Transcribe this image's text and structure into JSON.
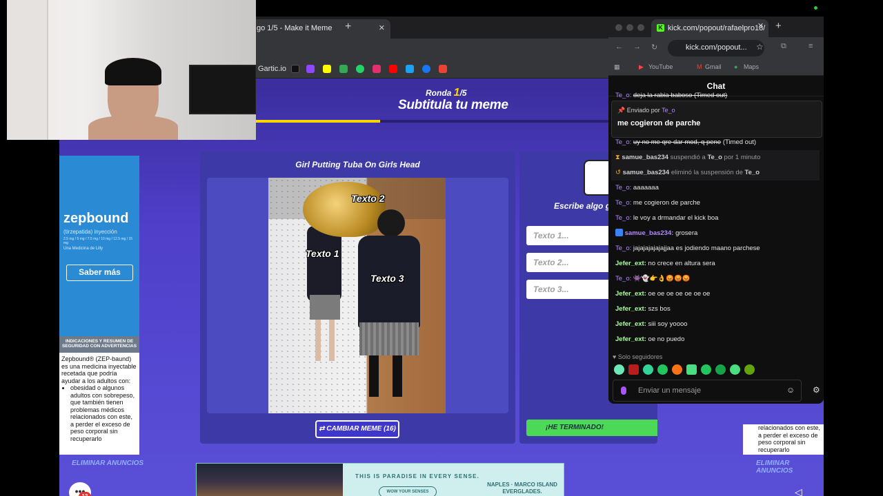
{
  "main_browser": {
    "tab_title": "go 1/5 - Make it Meme",
    "tab_close": "✕",
    "new_tab": "+",
    "bookmark_label": "Gartic.io"
  },
  "game": {
    "round_prefix": "Ronda ",
    "round_current": "1",
    "round_total": "/5",
    "subtitle": "Subtitula tu meme",
    "progress": 0.3,
    "meme_title": "Girl Putting Tuba On Girls Head",
    "meme_labels": {
      "t1": "Texto 1",
      "t2": "Texto 2",
      "t3": "Texto 3"
    },
    "cambiar_label": "CAMBIAR MEME (16)",
    "escribe_label": "Escribe algo gra",
    "inputs": {
      "p1": "Texto 1...",
      "p2": "Texto 2...",
      "p3": "Texto 3..."
    },
    "terminado_label": "¡HE TERMINADO!",
    "eliminar_left": "ELIMINAR ANUNCIOS",
    "eliminar_right": "ELIMINAR ANUNCIOS",
    "chat_count": "13"
  },
  "left_ad": {
    "logo": "zepbound",
    "sub": "(tirzepatida) inyección",
    "doses": "2.5 mg / 5 mg / 7.5 mg / 10 mg / 12.5 mg / 15 mg",
    "brand": "Una Medicina de Lilly",
    "cta": "Saber más",
    "info_head": "INDICACIONES Y RESUMEN DE SEGURIDAD CON ADVERTENCIAS",
    "body_intro": "Zepbound® (ZEP-baund) es una medicina inyectable recetada que podría ayudar a los adultos con:",
    "body_bullet": "obesidad o algunos adultos con sobrepeso, que también tienen problemas médicos relacionados con este, a perder el exceso de peso corporal sin recuperarlo"
  },
  "right_ad": {
    "body": "relacionados con este, a perder el exceso de peso corporal sin recuperarlo"
  },
  "bottom_ad": {
    "headline": "THIS IS PARADISE IN EVERY SENSE.",
    "cta": "WOW YOUR SENSES",
    "brand": "NAPLES · MARCO ISLAND EVERGLADES."
  },
  "kick": {
    "tab_title": "kick.com/popout/rafaelpro18/",
    "url": "kick.com/popout...",
    "bookmarks": [
      "YouTube",
      "Gmail",
      "Maps"
    ],
    "chat_title": "Chat",
    "partial_top": "deja la rabia baboso (Timed out)",
    "partial_top_user": "Te_o:",
    "pinned_label": "Enviado por",
    "pinned_user": "Te_o",
    "pinned_msg": "me cogieron de parche",
    "messages": [
      {
        "user": "Te_o:",
        "text": "uy no me qre dar mod, q pene",
        "extra": "(Timed out)"
      },
      {
        "user": "samue_bas234",
        "text": "suspendió a",
        "target": "Te_o",
        "tail": "por 1 minuto"
      },
      {
        "user": "samue_bas234",
        "text": "eliminó la suspensión de",
        "target": "Te_o"
      },
      {
        "user": "Te_o:",
        "text": "aaaaaaa"
      },
      {
        "user": "Te_o:",
        "text": "me cogieron de parche"
      },
      {
        "user": "Te_o:",
        "text": "le voy a drmandar el kick boa"
      },
      {
        "user": "samue_bas234:",
        "text": "grosera"
      },
      {
        "user": "Te_o:",
        "text": "jajajajajajajjaa es jodiendo maano parchese"
      },
      {
        "user": "Jefer_ext:",
        "text": "no crece en altura sera"
      },
      {
        "user": "Te_o:",
        "text": "👾👻👉👌😡😡😡"
      },
      {
        "user": "Jefer_ext:",
        "text": "oe oe oe oe oe oe oe"
      },
      {
        "user": "Jefer_ext:",
        "text": "szs bos"
      },
      {
        "user": "Jefer_ext:",
        "text": "siii soy yoooo"
      },
      {
        "user": "Jefer_ext:",
        "text": "oe no puedo"
      }
    ],
    "solo": "Solo seguidores",
    "input_placeholder": "Enviar un mensaje"
  },
  "colors": {
    "game_bg": "#4f3fc9",
    "kick_green": "#53fc18",
    "progress": "#ffd400",
    "terminado": "#4bd957"
  }
}
